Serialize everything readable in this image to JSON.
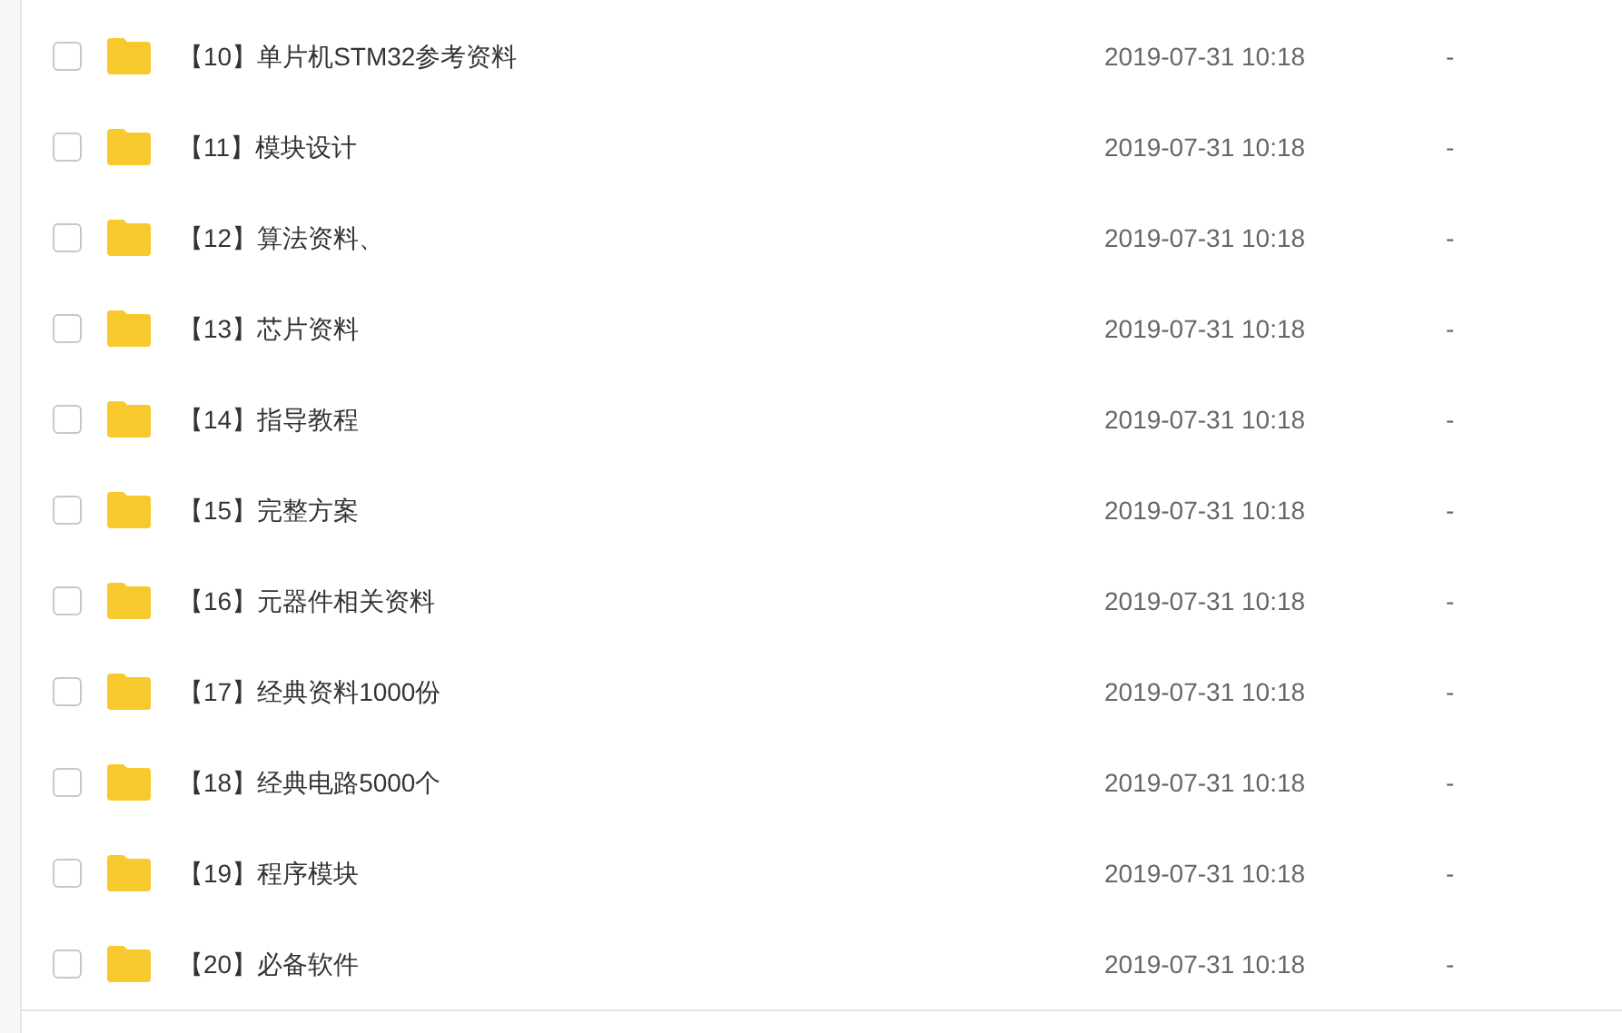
{
  "files": [
    {
      "name": "【10】单片机STM32参考资料",
      "modified": "2019-07-31 10:18",
      "size": "-",
      "checked": false
    },
    {
      "name": "【11】模块设计",
      "modified": "2019-07-31 10:18",
      "size": "-",
      "checked": false
    },
    {
      "name": "【12】算法资料、",
      "modified": "2019-07-31 10:18",
      "size": "-",
      "checked": false
    },
    {
      "name": "【13】芯片资料",
      "modified": "2019-07-31 10:18",
      "size": "-",
      "checked": false
    },
    {
      "name": "【14】指导教程",
      "modified": "2019-07-31 10:18",
      "size": "-",
      "checked": false
    },
    {
      "name": "【15】完整方案",
      "modified": "2019-07-31 10:18",
      "size": "-",
      "checked": false
    },
    {
      "name": "【16】元器件相关资料",
      "modified": "2019-07-31 10:18",
      "size": "-",
      "checked": false
    },
    {
      "name": "【17】经典资料1000份",
      "modified": "2019-07-31 10:18",
      "size": "-",
      "checked": false
    },
    {
      "name": "【18】经典电路5000个",
      "modified": "2019-07-31 10:18",
      "size": "-",
      "checked": false
    },
    {
      "name": "【19】程序模块",
      "modified": "2019-07-31 10:18",
      "size": "-",
      "checked": false
    },
    {
      "name": "【20】必备软件",
      "modified": "2019-07-31 10:18",
      "size": "-",
      "checked": false
    }
  ]
}
